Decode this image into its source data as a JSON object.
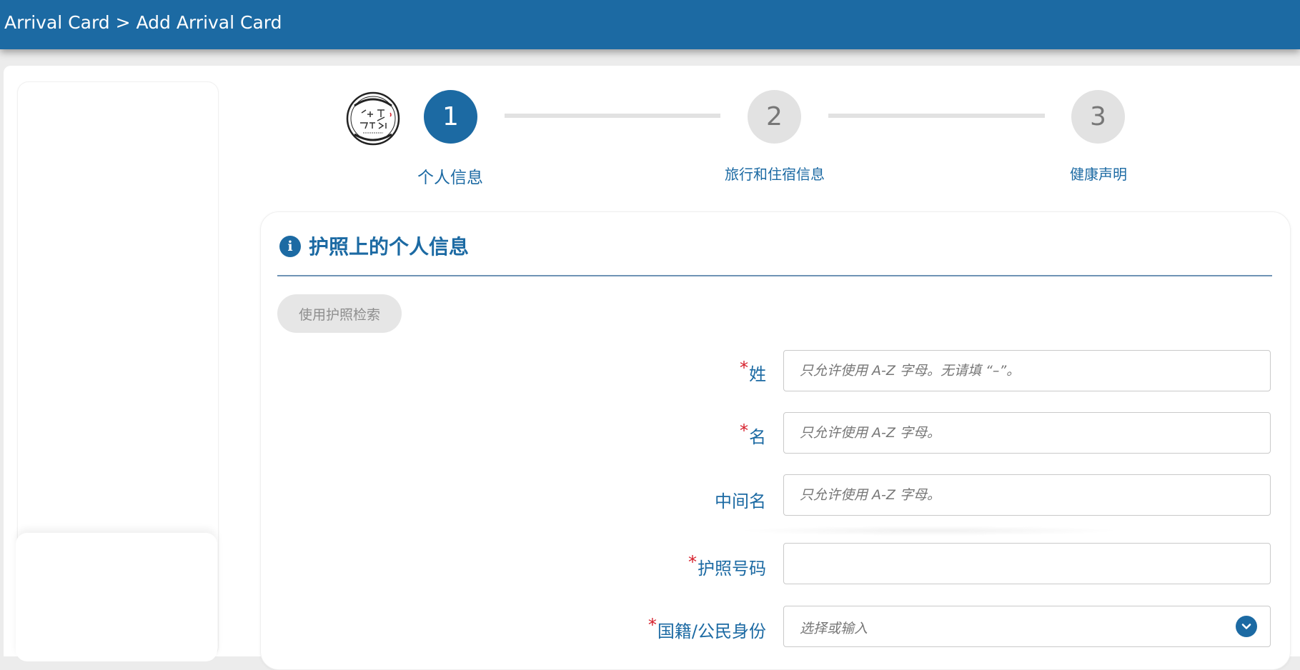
{
  "header": {
    "breadcrumb": "Arrival Card > Add Arrival Card"
  },
  "stepper": {
    "steps": [
      {
        "number": "1",
        "label": "个人信息",
        "state": "active"
      },
      {
        "number": "2",
        "label": "旅行和住宿信息",
        "state": "inactive"
      },
      {
        "number": "3",
        "label": "健康声明",
        "state": "inactive"
      }
    ],
    "logo_icon": "smile-seal-logo"
  },
  "section": {
    "icon": "info-icon",
    "title": "护照上的个人信息",
    "passport_search_button": "使用护照检索"
  },
  "form": {
    "required_marker": "*",
    "fields": [
      {
        "label": "姓",
        "required": true,
        "placeholder": "只允许使用 A-Z 字母。无请填 “–”。",
        "value": ""
      },
      {
        "label": "名",
        "required": true,
        "placeholder": "只允许使用 A-Z 字母。",
        "value": ""
      },
      {
        "label": "中间名",
        "required": false,
        "placeholder": "只允许使用 A-Z 字母。",
        "value": ""
      },
      {
        "label": "护照号码",
        "required": true,
        "placeholder": "",
        "value": ""
      },
      {
        "label": "国籍/公民身份",
        "required": true,
        "placeholder": "选择或输入",
        "value": "",
        "type": "select",
        "icon": "chevron-down-icon"
      }
    ]
  },
  "colors": {
    "primary": "#1c6aa3",
    "required": "#d61f2b",
    "inactive_step": "#e2e2e2"
  }
}
